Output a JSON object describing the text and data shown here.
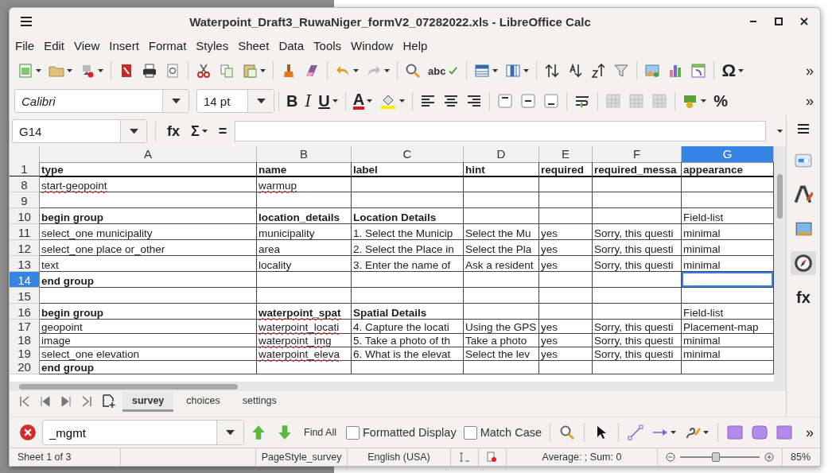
{
  "window": {
    "title": "Waterpoint_Draft3_RuwaNiger_formV2_07282022.xls - LibreOffice Calc"
  },
  "menu": [
    "File",
    "Edit",
    "View",
    "Insert",
    "Format",
    "Styles",
    "Sheet",
    "Data",
    "Tools",
    "Window",
    "Help"
  ],
  "standard_toolbar": {
    "spelling": "abc",
    "special_character": "Ω",
    "more": "»"
  },
  "formatting_toolbar": {
    "font_name": "Calibri",
    "font_size": "14 pt",
    "bold": "B",
    "italic": "I",
    "underline": "U",
    "font_color": "A",
    "percent": "%",
    "more": "»"
  },
  "formula_bar": {
    "cell_reference": "G14",
    "function_wizard": "fx",
    "sum": "Σ",
    "formula": "="
  },
  "sheet": {
    "columns": [
      {
        "label": "A",
        "selected": false
      },
      {
        "label": "B",
        "selected": false
      },
      {
        "label": "C",
        "selected": false
      },
      {
        "label": "D",
        "selected": false
      },
      {
        "label": "E",
        "selected": false
      },
      {
        "label": "F",
        "selected": false
      },
      {
        "label": "G",
        "selected": true
      }
    ],
    "rows": [
      {
        "number": "1",
        "selected": false,
        "cells": [
          {
            "text": "type",
            "bold": true,
            "misspelled": false
          },
          {
            "text": "name",
            "bold": true,
            "misspelled": false
          },
          {
            "text": "label",
            "bold": true,
            "misspelled": false
          },
          {
            "text": "hint",
            "bold": true,
            "misspelled": false
          },
          {
            "text": "required",
            "bold": true,
            "misspelled": false
          },
          {
            "text": "required_messa",
            "bold": true,
            "misspelled": false
          },
          {
            "text": "appearance",
            "bold": true,
            "misspelled": false
          }
        ]
      },
      {
        "number": "8",
        "selected": false,
        "cells": [
          {
            "text": "start-geopoint",
            "bold": false,
            "misspelled": true
          },
          {
            "text": "warmup",
            "bold": false,
            "misspelled": true
          },
          null,
          null,
          null,
          null,
          null
        ]
      },
      {
        "number": "9",
        "selected": false,
        "cells": [
          null,
          null,
          null,
          null,
          null,
          null,
          null
        ]
      },
      {
        "number": "10",
        "selected": false,
        "cells": [
          {
            "text": "begin group",
            "bold": true,
            "misspelled": false
          },
          {
            "text": "location_details",
            "bold": true,
            "misspelled": false
          },
          {
            "text": "Location Details",
            "bold": true,
            "misspelled": false
          },
          null,
          null,
          null,
          {
            "text": "Field-list",
            "bold": false,
            "misspelled": false
          }
        ]
      },
      {
        "number": "11",
        "selected": false,
        "cells": [
          {
            "text": "select_one municipality",
            "bold": false,
            "misspelled": false
          },
          {
            "text": "municipality",
            "bold": false,
            "misspelled": false
          },
          {
            "text": "1. Select the Municip",
            "bold": false,
            "misspelled": false
          },
          {
            "text": "Select the Mu",
            "bold": false,
            "misspelled": false
          },
          {
            "text": "yes",
            "bold": false,
            "misspelled": false
          },
          {
            "text": "Sorry, this questi",
            "bold": false,
            "misspelled": false
          },
          {
            "text": "minimal",
            "bold": false,
            "misspelled": false
          }
        ]
      },
      {
        "number": "12",
        "selected": false,
        "cells": [
          {
            "text": "select_one place or_other",
            "bold": false,
            "misspelled": false
          },
          {
            "text": "area",
            "bold": false,
            "misspelled": false
          },
          {
            "text": "2. Select the Place in",
            "bold": false,
            "misspelled": false
          },
          {
            "text": "Select the Pla",
            "bold": false,
            "misspelled": false
          },
          {
            "text": "yes",
            "bold": false,
            "misspelled": false
          },
          {
            "text": "Sorry, this questi",
            "bold": false,
            "misspelled": false
          },
          {
            "text": "minimal",
            "bold": false,
            "misspelled": false
          }
        ]
      },
      {
        "number": "13",
        "selected": false,
        "cells": [
          {
            "text": "text",
            "bold": false,
            "misspelled": false
          },
          {
            "text": "locality",
            "bold": false,
            "misspelled": false
          },
          {
            "text": "3. Enter the name of",
            "bold": false,
            "misspelled": false
          },
          {
            "text": "Ask a resident",
            "bold": false,
            "misspelled": false
          },
          {
            "text": "yes",
            "bold": false,
            "misspelled": false
          },
          {
            "text": "Sorry, this questi",
            "bold": false,
            "misspelled": false
          },
          {
            "text": "minimal",
            "bold": false,
            "misspelled": false
          }
        ]
      },
      {
        "number": "14",
        "selected": true,
        "cells": [
          {
            "text": "end group",
            "bold": true,
            "misspelled": false
          },
          null,
          null,
          null,
          null,
          null,
          null
        ]
      },
      {
        "number": "15",
        "selected": false,
        "cells": [
          null,
          null,
          null,
          null,
          null,
          null,
          null
        ]
      },
      {
        "number": "16",
        "selected": false,
        "cells": [
          {
            "text": "begin group",
            "bold": true,
            "misspelled": false
          },
          {
            "text": "waterpoint_spat",
            "bold": true,
            "misspelled": true
          },
          {
            "text": "Spatial Details",
            "bold": true,
            "misspelled": false
          },
          null,
          null,
          null,
          {
            "text": "Field-list",
            "bold": false,
            "misspelled": false
          }
        ]
      },
      {
        "number": "17",
        "selected": false,
        "cells": [
          {
            "text": "geopoint",
            "bold": false,
            "misspelled": false
          },
          {
            "text": "waterpoint_locati",
            "bold": false,
            "misspelled": true
          },
          {
            "text": "4. Capture the locati",
            "bold": false,
            "misspelled": false
          },
          {
            "text": "Using the GPS",
            "bold": false,
            "misspelled": false
          },
          {
            "text": "yes",
            "bold": false,
            "misspelled": false
          },
          {
            "text": "Sorry, this questi",
            "bold": false,
            "misspelled": false
          },
          {
            "text": "Placement-map",
            "bold": false,
            "misspelled": false
          }
        ]
      },
      {
        "number": "18",
        "selected": false,
        "cells": [
          {
            "text": "image",
            "bold": false,
            "misspelled": false
          },
          {
            "text": "waterpoint_img",
            "bold": false,
            "misspelled": true
          },
          {
            "text": "5. Take a photo of th",
            "bold": false,
            "misspelled": false
          },
          {
            "text": "Take a photo",
            "bold": false,
            "misspelled": false
          },
          {
            "text": "yes",
            "bold": false,
            "misspelled": false
          },
          {
            "text": "Sorry, this questi",
            "bold": false,
            "misspelled": false
          },
          {
            "text": "minimal",
            "bold": false,
            "misspelled": false
          }
        ]
      },
      {
        "number": "19",
        "selected": false,
        "cells": [
          {
            "text": "select_one elevation",
            "bold": false,
            "misspelled": false
          },
          {
            "text": "waterpoint_eleva",
            "bold": false,
            "misspelled": true
          },
          {
            "text": "6. What is the elevat",
            "bold": false,
            "misspelled": false
          },
          {
            "text": "Select the lev",
            "bold": false,
            "misspelled": false
          },
          {
            "text": "yes",
            "bold": false,
            "misspelled": false
          },
          {
            "text": "Sorry, this questi",
            "bold": false,
            "misspelled": false
          },
          {
            "text": "minimal",
            "bold": false,
            "misspelled": false
          }
        ]
      },
      {
        "number": "20",
        "selected": false,
        "cells": [
          {
            "text": "end group",
            "bold": true,
            "misspelled": false
          },
          null,
          null,
          null,
          null,
          null,
          null
        ]
      }
    ]
  },
  "sidebar": {
    "functions": "fx"
  },
  "sheet_tabs": [
    {
      "label": "survey",
      "selected": true
    },
    {
      "label": "choices",
      "selected": false
    },
    {
      "label": "settings",
      "selected": false
    }
  ],
  "find_bar": {
    "search": {
      "value": "_mgmt"
    },
    "find_all": "Find All",
    "options": [
      {
        "label": "Formatted Display",
        "checked": false
      },
      {
        "label": "Match Case",
        "checked": false
      }
    ],
    "more": "»"
  },
  "status_bar": {
    "sheet": "Sheet 1 of 3",
    "page_style": "PageStyle_survey",
    "language": "English (USA)",
    "summary": "Average: ; Sum: 0",
    "zoom": {
      "level": 0.45
    },
    "zoom_percent": "85%"
  }
}
